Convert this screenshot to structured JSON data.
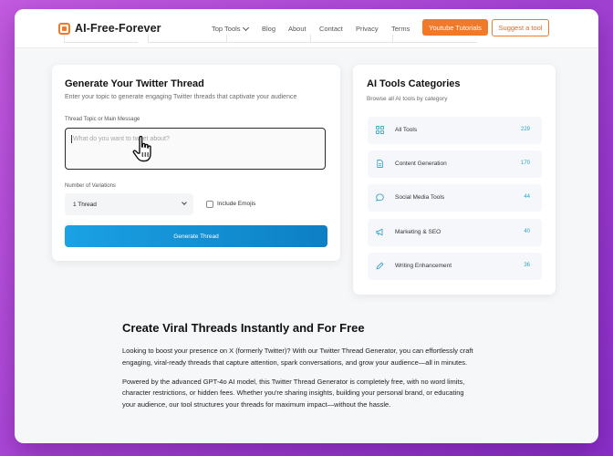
{
  "brand": {
    "name": "AI-Free-Forever",
    "accent": "#f07a2a",
    "primary": "#1590d3"
  },
  "nav": {
    "items": [
      {
        "label": "Top Tools",
        "has_dropdown": true
      },
      {
        "label": "Blog"
      },
      {
        "label": "About"
      },
      {
        "label": "Contact"
      },
      {
        "label": "Privacy"
      },
      {
        "label": "Terms"
      }
    ],
    "youtube_label": "Youtube Tutorials",
    "suggest_label": "Suggest a tool"
  },
  "generator": {
    "title": "Generate Your Twitter Thread",
    "subtitle": "Enter your topic to generate engaging Twitter threads that captivate your audience",
    "topic_label": "Thread Topic or Main Message",
    "topic_placeholder": "What do you want to tweet about?",
    "topic_value": "",
    "variations_label": "Number of Variations",
    "variations_selected": "1 Thread",
    "emoji_label": "Include Emojis",
    "emoji_checked": false,
    "generate_label": "Generate Thread"
  },
  "categories": {
    "title": "AI Tools Categories",
    "subtitle": "Browse all AI tools by category",
    "items": [
      {
        "name": "All Tools",
        "count": "229",
        "icon": "grid-icon"
      },
      {
        "name": "Content Generation",
        "count": "170",
        "icon": "document-icon"
      },
      {
        "name": "Social Media Tools",
        "count": "44",
        "icon": "chat-bubble-icon"
      },
      {
        "name": "Marketing & SEO",
        "count": "40",
        "icon": "megaphone-icon"
      },
      {
        "name": "Writing Enhancement",
        "count": "36",
        "icon": "pencil-icon"
      }
    ]
  },
  "article": {
    "heading": "Create Viral Threads Instantly and For Free",
    "paragraphs": [
      "Looking to boost your presence on X (formerly Twitter)? With our Twitter Thread Generator, you can effortlessly craft engaging, viral-ready threads that capture attention, spark conversations, and grow your audience—all in minutes.",
      "Powered by the advanced GPT-4o AI model, this Twitter Thread Generator is completely free, with no word limits, character restrictions, or hidden fees. Whether you're sharing insights, building your personal brand, or educating your audience, our tool structures your threads for maximum impact—without the hassle."
    ]
  }
}
